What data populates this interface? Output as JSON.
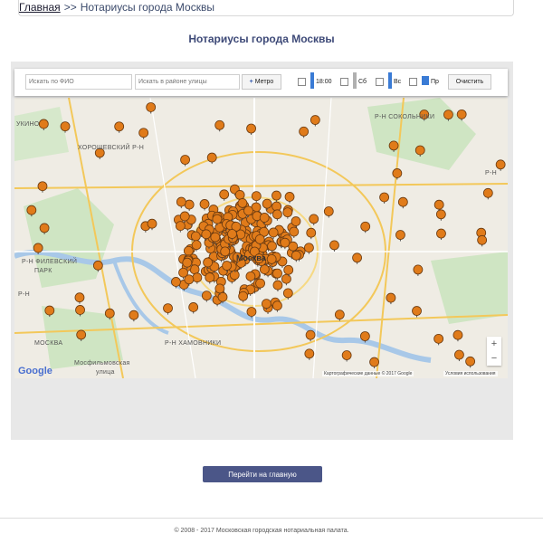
{
  "breadcrumb": {
    "home_label": "Главная",
    "separator": ">>",
    "current": "Нотариусы города Москвы"
  },
  "page_title": "Нотариусы города Москвы",
  "toolbar": {
    "search_fio_placeholder": "Искать по ФИО",
    "search_street_placeholder": "Искать в районе улицы",
    "metro_label": "Метро",
    "filters": [
      {
        "label": "18:00",
        "color": "#3a7bd5"
      },
      {
        "label": "Сб",
        "color": "#9a9a9a"
      },
      {
        "label": "Вс",
        "color": "#3a7bd5"
      },
      {
        "label": "Пр",
        "color": "#3a7bd5"
      }
    ],
    "clear_label": "Очистить"
  },
  "map": {
    "districts": [
      "УКИНО",
      "Р-Н СОКОЛЬНИКИ",
      "ХОРОШЕВСКИЙ Р-Н",
      "Р-Н ФИЛЕВСКИЙ",
      "ПАРК",
      "Р-Н",
      "МОСКВА",
      "Москва",
      "Р-Н ХАМОВНИКИ",
      "Мосфильмовская",
      "улица",
      "Р-Н"
    ],
    "city": "Москва",
    "google_logo": "Google",
    "attribution": "Картографические данные © 2017 Google",
    "terms": "Условия использования",
    "zoom_in": "+",
    "zoom_out": "−",
    "marker_color": "#e07b1a"
  },
  "home_button": "Перейти на главную",
  "footer": "© 2008 - 2017 Московская городская нотариальная палата."
}
